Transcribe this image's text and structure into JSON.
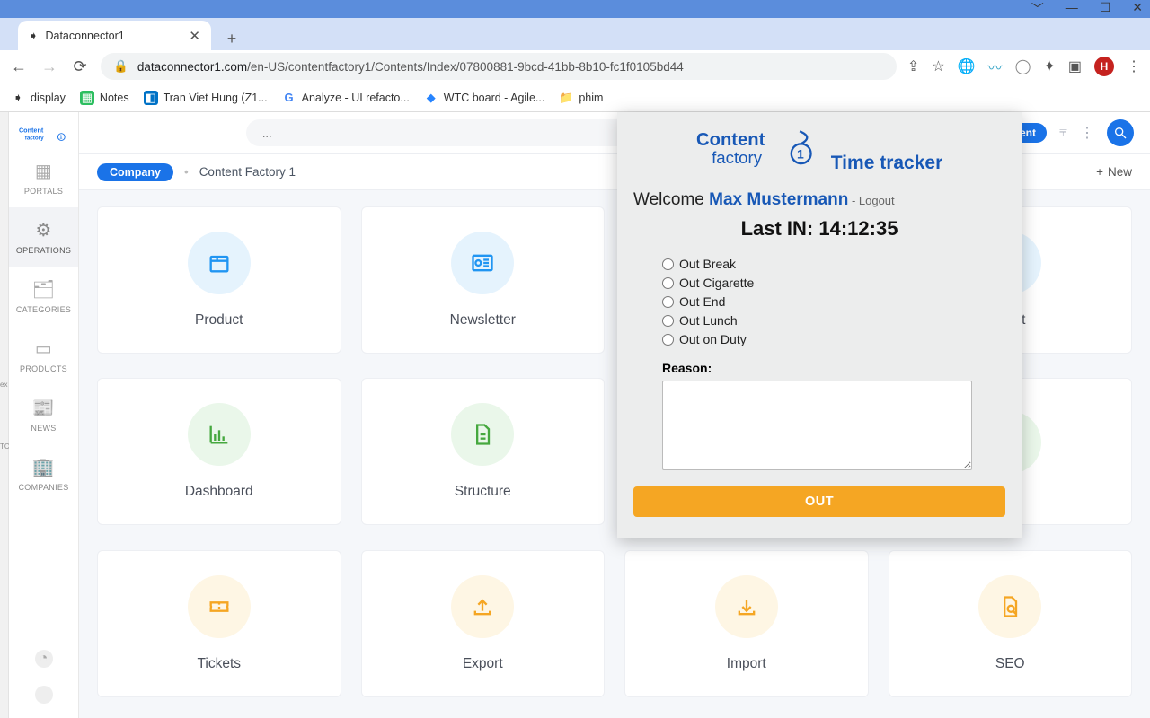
{
  "window": {
    "tab_title": "Dataconnector1"
  },
  "browser": {
    "url_domain": "dataconnector1.com",
    "url_path": "/en-US/contentfactory1/Contents/Index/07800881-9bcd-41bb-8b10-fc1f0105bd44",
    "avatar_letter": "H"
  },
  "bookmarks": [
    {
      "label": "display"
    },
    {
      "label": "Notes"
    },
    {
      "label": "Tran Viet Hung (Z1..."
    },
    {
      "label": "Analyze - UI refacto..."
    },
    {
      "label": "WTC board - Agile..."
    },
    {
      "label": "phim"
    }
  ],
  "sidebar": {
    "brand": "Content factory",
    "items": [
      {
        "label": "PORTALS"
      },
      {
        "label": "OPERATIONS"
      },
      {
        "label": "CATEGORIES"
      },
      {
        "label": "PRODUCTS"
      },
      {
        "label": "NEWS"
      },
      {
        "label": "COMPANIES"
      }
    ]
  },
  "topbar": {
    "search_placeholder": "...",
    "content_pill": "Content"
  },
  "breadcrumb": {
    "pill": "Company",
    "current": "Content Factory 1",
    "new_label": "New"
  },
  "cards": [
    {
      "label": "Product",
      "color": "blue",
      "icon": "box"
    },
    {
      "label": "Newsletter",
      "color": "blue",
      "icon": "news"
    },
    {
      "label": "",
      "color": "blue",
      "icon": "blank"
    },
    {
      "label": "ntent",
      "color": "blue",
      "icon": "doc"
    },
    {
      "label": "Dashboard",
      "color": "green",
      "icon": "chart"
    },
    {
      "label": "Structure",
      "color": "green",
      "icon": "file"
    },
    {
      "label": "",
      "color": "green",
      "icon": "blank"
    },
    {
      "label": "",
      "color": "green",
      "icon": "gearuser"
    },
    {
      "label": "Tickets",
      "color": "yellow",
      "icon": "ticket"
    },
    {
      "label": "Export",
      "color": "yellow",
      "icon": "upload"
    },
    {
      "label": "Import",
      "color": "yellow",
      "icon": "download"
    },
    {
      "label": "SEO",
      "color": "yellow",
      "icon": "docsearch"
    }
  ],
  "popup": {
    "brand": "Content factory",
    "title": "Time tracker",
    "welcome_prefix": "Welcome ",
    "user": "Max Mustermann",
    "logout_sep": " - ",
    "logout": "Logout",
    "last_in_label": "Last IN: ",
    "last_in_time": "14:12:35",
    "radios": [
      "Out Break",
      "Out Cigarette",
      "Out End",
      "Out Lunch",
      "Out on Duty"
    ],
    "reason_label": "Reason:",
    "out_button": "OUT"
  }
}
